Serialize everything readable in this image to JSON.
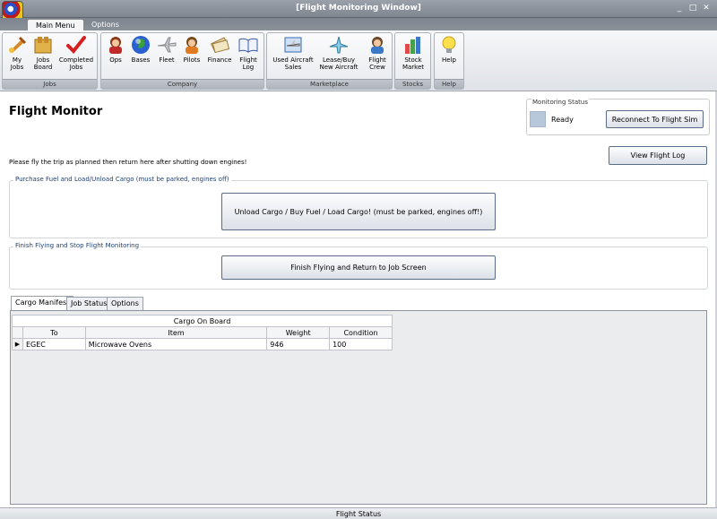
{
  "window": {
    "title": "[Flight Monitoring Window]",
    "minimize": "_",
    "restore": "□",
    "close": "✕"
  },
  "ribbon_tabs": [
    "Main Menu",
    "Options"
  ],
  "ribbon": {
    "groups": [
      {
        "label": "Jobs",
        "buttons": [
          {
            "label": "My Jobs",
            "icon": "my-jobs-icon"
          },
          {
            "label": "Jobs Board",
            "icon": "jobs-board-icon"
          },
          {
            "label": "Completed Jobs",
            "icon": "completed-jobs-icon"
          }
        ]
      },
      {
        "label": "Company",
        "buttons": [
          {
            "label": "Ops",
            "icon": "ops-icon"
          },
          {
            "label": "Bases",
            "icon": "globe-icon"
          },
          {
            "label": "Fleet",
            "icon": "airplane-icon"
          },
          {
            "label": "Pilots",
            "icon": "pilot-icon"
          },
          {
            "label": "Finance",
            "icon": "money-icon"
          },
          {
            "label": "Flight Log",
            "icon": "book-icon"
          }
        ]
      },
      {
        "label": "Marketplace",
        "buttons": [
          {
            "label": "Used Aircraft Sales",
            "icon": "used-aircraft-icon"
          },
          {
            "label": "Lease/Buy New Aircraft",
            "icon": "new-aircraft-icon"
          },
          {
            "label": "Flight Crew",
            "icon": "flight-crew-icon"
          }
        ]
      },
      {
        "label": "Stocks",
        "buttons": [
          {
            "label": "Stock Market",
            "icon": "stock-market-icon"
          }
        ]
      },
      {
        "label": "Help",
        "buttons": [
          {
            "label": "Help",
            "icon": "lightbulb-icon"
          }
        ]
      }
    ]
  },
  "main": {
    "title": "Flight Monitor",
    "instructions": "Please fly the trip as planned then return here after shutting down engines!",
    "monitoring": {
      "legend": "Monitoring Status",
      "status": "Ready",
      "status_color": "#b8c8dc",
      "reconnect_label": "Reconnect To Flight Sim"
    },
    "view_log_label": "View Flight Log",
    "cargo_section": {
      "legend": "Purchase Fuel and Load/Unload Cargo (must be parked, engines off)",
      "button": "Unload Cargo / Buy Fuel / Load Cargo!  (must be parked, engines off!)"
    },
    "finish_section": {
      "legend": "Finish Flying and Stop Flight Monitoring",
      "button": "Finish Flying and Return to Job Screen"
    }
  },
  "tabs": [
    "Cargo Manifest",
    "Job Status",
    "Options"
  ],
  "grid": {
    "caption": "Cargo On Board",
    "columns": [
      "To",
      "Item",
      "Weight",
      "Condition"
    ],
    "rows": [
      {
        "to": "EGEC",
        "item": "Microwave Ovens",
        "weight": "946",
        "condition": "100"
      }
    ]
  },
  "status_bar": "Flight Status"
}
